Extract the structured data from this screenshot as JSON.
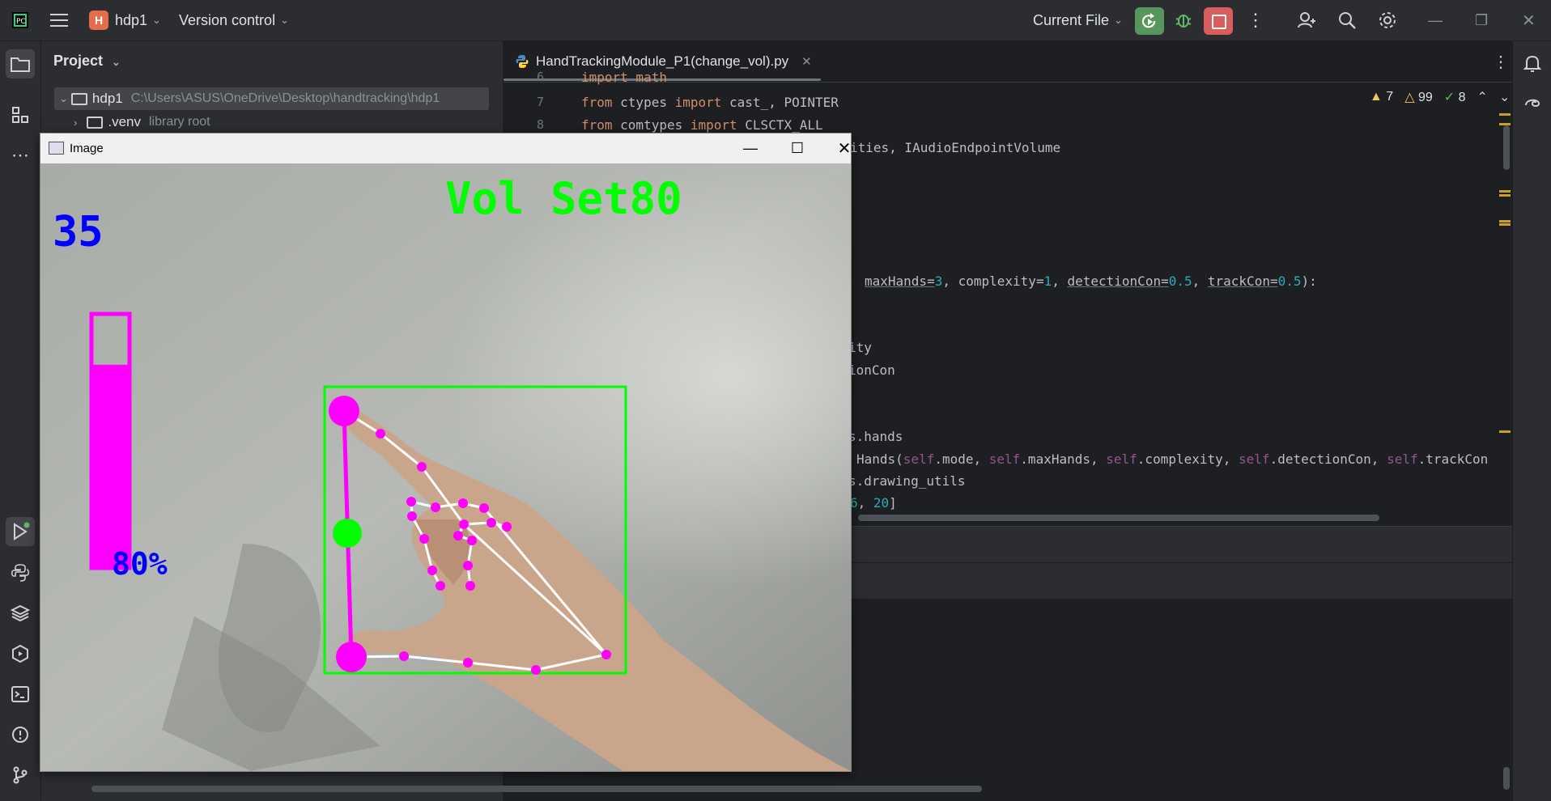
{
  "titlebar": {
    "project_initial": "H",
    "project_name": "hdp1",
    "vcs_label": "Version control",
    "run_config": "Current File"
  },
  "project_panel": {
    "title": "Project",
    "root_name": "hdp1",
    "root_path": "C:\\Users\\ASUS\\OneDrive\\Desktop\\handtracking\\hdp1",
    "venv_name": ".venv",
    "venv_note": "library root"
  },
  "editor": {
    "tab_name": "HandTrackingModule_P1(change_vol).py",
    "inspections": {
      "errors": "7",
      "warnings": "99",
      "ok": "8"
    },
    "line_numbers": [
      "6",
      "7",
      "8"
    ],
    "lines": {
      "l6": "import math",
      "l7_kw": "from",
      "l7_mod": " ctypes ",
      "l7_kw2": "import",
      "l7_rest": " cast_, POINTER",
      "l8_kw": "from",
      "l8_mod": " comtypes ",
      "l8_kw2": "import",
      "l8_rest": " CLSCTX_ALL",
      "l9": "ities, IAudioEndpointVolume",
      "l13_a": "maxHands=",
      "l13_b": "3",
      "l13_c": ", complexity=",
      "l13_d": "1",
      "l13_e": ", ",
      "l13_f": "detectionCon=",
      "l13_g": "0.5",
      "l13_h": ", ",
      "l13_i": "trackCon=",
      "l13_j": "0.5",
      "l13_k": "):",
      "l16": "ity",
      "l17": "ionCon",
      "l20": "s.hands",
      "l21_a": "Hands(",
      "l21_b": "self",
      "l21_c": ".mode, ",
      "l21_d": "self",
      "l21_e": ".maxHands, ",
      "l21_f": "self",
      "l21_g": ".complexity, ",
      "l21_h": "self",
      "l21_i": ".detectionCon, ",
      "l21_j": "self",
      "l21_k": ".trackCon",
      "l22": "s.drawing_utils",
      "l23_a": "6",
      "l23_b": ", ",
      "l23_c": "20",
      "l23_d": "]"
    }
  },
  "image_window": {
    "title": "Image",
    "fps_text": "35",
    "vol_set_text": "Vol Set80",
    "percent_text": "80%",
    "volume_level_fraction": 0.8,
    "colors": {
      "magenta": "#ff00ff",
      "green": "#00ff00",
      "blue": "#0000ff"
    }
  }
}
